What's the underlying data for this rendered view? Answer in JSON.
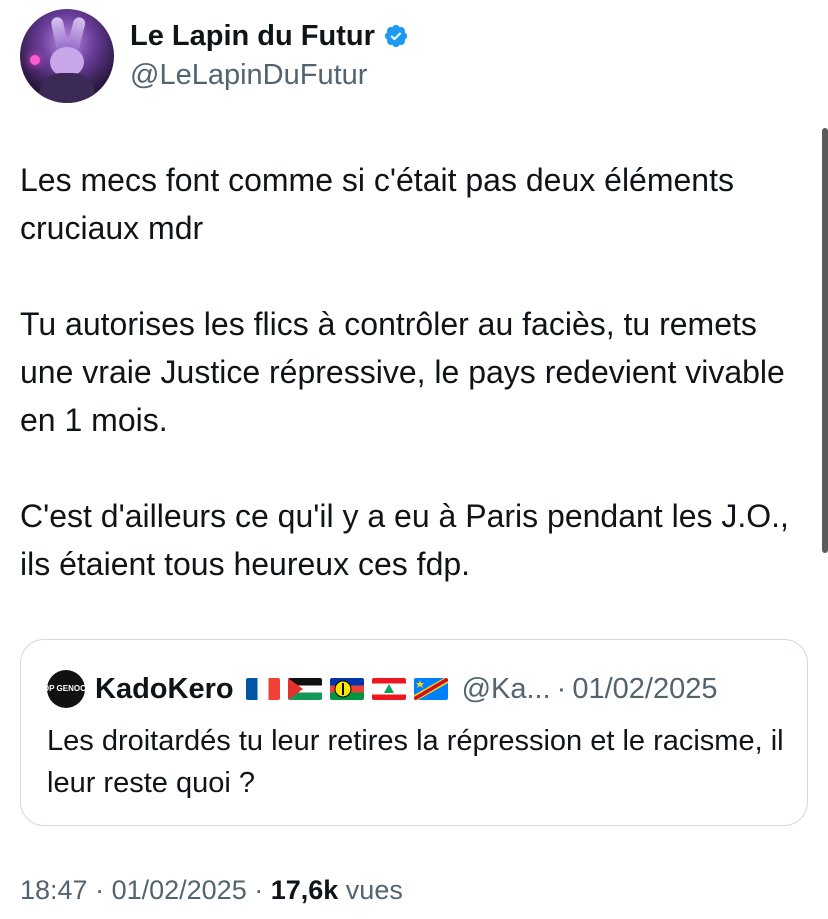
{
  "author": {
    "display_name": "Le Lapin du Futur",
    "handle": "@LeLapinDuFutur",
    "verified": true
  },
  "tweet": {
    "text": "Les mecs font comme si c'était pas deux éléments cruciaux mdr\n\nTu autorises les flics à contrôler au faciès, tu remets une vraie Justice répressive, le pays redevient vivable en 1 mois.\n\nC'est d'ailleurs ce qu'il y a eu à Paris pendant les J.O., ils étaient tous heureux ces fdp."
  },
  "quote": {
    "avatar_text": "STOP GENOCIDE",
    "display_name": "KadoKero",
    "flags": [
      "france-flag",
      "palestine-flag",
      "new-caledonia-flag",
      "lebanon-flag",
      "congo-flag"
    ],
    "handle": "@Ka...",
    "separator": "·",
    "date": "01/02/2025",
    "text": "Les droitardés tu leur retires la répression et le racisme, il leur reste quoi  ?"
  },
  "meta": {
    "time": "18:47",
    "sep1": " · ",
    "date": "01/02/2025",
    "sep2": " · ",
    "views_count": "17,6k",
    "views_label": " vues"
  },
  "colors": {
    "verified_blue": "#1d9bf0",
    "secondary_text": "#536471",
    "border": "#cfd9de"
  }
}
